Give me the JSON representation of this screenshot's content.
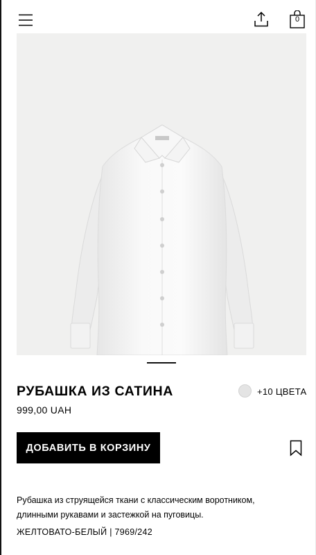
{
  "header": {
    "menu_icon": "hamburger-menu-icon",
    "share_icon": "share-icon",
    "cart_icon": "shopping-bag-icon",
    "cart_count": "0"
  },
  "product": {
    "image_alt": "white satin shirt",
    "title": "РУБАШКА ИЗ САТИНА",
    "price": "999,00 UAH",
    "swatch_color": "#e4e4e4",
    "more_colors": "+10 ЦВЕТА",
    "add_to_cart_label": "ДОБАВИТЬ В КОРЗИНУ",
    "bookmark_icon": "bookmark-icon",
    "description": "Рубашка из струящейся ткани с классическим воротником, длинными рукавами и застежкой на пуговицы.",
    "color_code": "ЖЕЛТОВАТО-БЕЛЫЙ | 7969/242"
  },
  "gallery": {
    "current_slide": 1
  },
  "colors": {
    "background": "#ffffff",
    "text": "#000000",
    "image_background": "#f0f0ef",
    "button": "#000000"
  }
}
